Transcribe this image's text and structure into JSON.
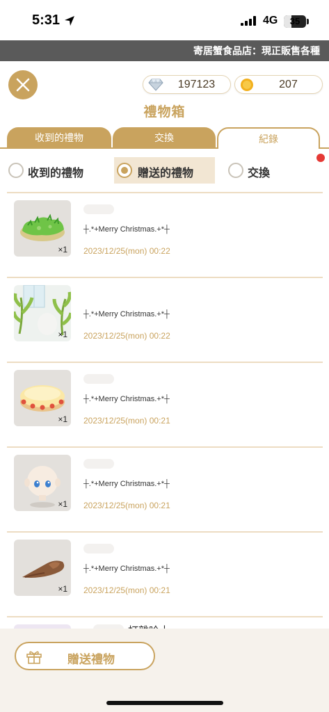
{
  "status_bar": {
    "time": "5:31",
    "network": "4G",
    "battery": "35",
    "battery_level": 0.35
  },
  "marquee": {
    "text": "寄居蟹食品店：現正販售各種"
  },
  "header": {
    "title": "禮物箱",
    "gems": "197123",
    "coins": "207"
  },
  "tabs": [
    {
      "label": "收到的禮物"
    },
    {
      "label": "交換"
    },
    {
      "label": "紀錄"
    }
  ],
  "filters": [
    {
      "label": "收到的禮物",
      "selected": false
    },
    {
      "label": "贈送的禮物",
      "selected": true
    },
    {
      "label": "交換",
      "selected": false
    }
  ],
  "records": [
    {
      "item": "grass-patch",
      "qty": "×1",
      "message": "┼.*+Merry Christmas.+*┼",
      "date": "2023/12/25(mon) 00:22"
    },
    {
      "item": "banana-plants",
      "qty": "×1",
      "message": "┼.*+Merry Christmas.+*┼",
      "date": "2023/12/25(mon) 00:22"
    },
    {
      "item": "cake",
      "qty": "×1",
      "message": "┼.*+Merry Christmas.+*┼",
      "date": "2023/12/25(mon) 00:21"
    },
    {
      "item": "doll-head",
      "qty": "×1",
      "message": "┼.*+Merry Christmas.+*┼",
      "date": "2023/12/25(mon) 00:21"
    },
    {
      "item": "brown-hair",
      "qty": "×1",
      "message": "┼.*+Merry Christmas.+*┼",
      "date": "2023/12/25(mon) 00:21"
    }
  ],
  "partial_record": {
    "sender": "打雜哈士"
  },
  "bottom": {
    "send_button": "贈送禮物"
  },
  "colors": {
    "accent": "#c9a35e",
    "marquee_bg": "#5a5a5a",
    "date_text": "#c9a35e",
    "notify": "#e53935"
  }
}
